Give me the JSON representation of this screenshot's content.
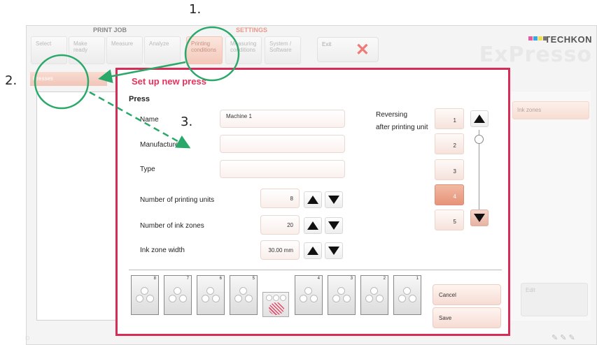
{
  "header": {
    "group_print_job": "PRINT JOB",
    "group_settings": "SETTINGS",
    "tabs": [
      "Select",
      "Make ready",
      "Measure",
      "Analyze"
    ],
    "settings_tabs": [
      {
        "line1": "Printing",
        "line2": "conditions"
      },
      {
        "line1": "Measuring",
        "line2": "conditions"
      },
      {
        "line1": "System /",
        "line2": "Software"
      }
    ],
    "exit_label": "Exit",
    "brand_top": "TECHKON",
    "brand_main": "ExPresso"
  },
  "subtab": "Presses",
  "right_panel": {
    "ink_zones": "Ink zones",
    "edit": "Edit"
  },
  "dialog": {
    "title": "Set up new press",
    "section": "Press",
    "name_label": "Name",
    "name_value": "Machine 1",
    "manufacturer_label": "Manufacturer",
    "manufacturer_value": "",
    "type_label": "Type",
    "type_value": "",
    "printing_units_label": "Number of printing units",
    "printing_units_value": "8",
    "ink_zones_label": "Number of ink zones",
    "ink_zones_value": "20",
    "ink_zone_width_label": "Ink zone width",
    "ink_zone_width_value": "30.00 mm",
    "reversing_line1": "Reversing",
    "reversing_line2": "after printing unit",
    "units": [
      "1",
      "2",
      "3",
      "4",
      "5"
    ],
    "selected_unit": "4",
    "strip_units": [
      "8",
      "7",
      "6",
      "5",
      "4",
      "3",
      "2",
      "1"
    ],
    "cancel": "Cancel",
    "save": "Save"
  },
  "annotations": {
    "step1": "1.",
    "step2": "2.",
    "step3": "3."
  },
  "colors": {
    "accent": "#d72c55",
    "annotation_green": "#2aa86a",
    "selected_unit": "#e79379"
  }
}
